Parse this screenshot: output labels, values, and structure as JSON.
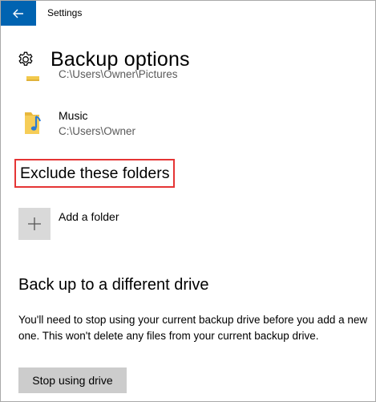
{
  "window": {
    "title": "Settings"
  },
  "page": {
    "title": "Backup options",
    "icon": "gear-icon"
  },
  "backup_folders": [
    {
      "name": "",
      "path": "C:\\Users\\Owner\\Pictures",
      "icon": "folder-icon"
    },
    {
      "name": "Music",
      "path": "C:\\Users\\Owner",
      "icon": "music-folder-icon"
    }
  ],
  "exclude": {
    "heading": "Exclude these folders",
    "add_label": "Add a folder",
    "add_icon": "plus-icon"
  },
  "drive": {
    "heading": "Back up to a different drive",
    "description": "You'll need to stop using your current backup drive before you add a new one. This won't delete any files from your current backup drive.",
    "button_label": "Stop using drive"
  },
  "colors": {
    "accent": "#0063b1",
    "highlight_box": "#e53535",
    "button_bg": "#cccccc",
    "tile_bg": "#d9d9d9"
  }
}
